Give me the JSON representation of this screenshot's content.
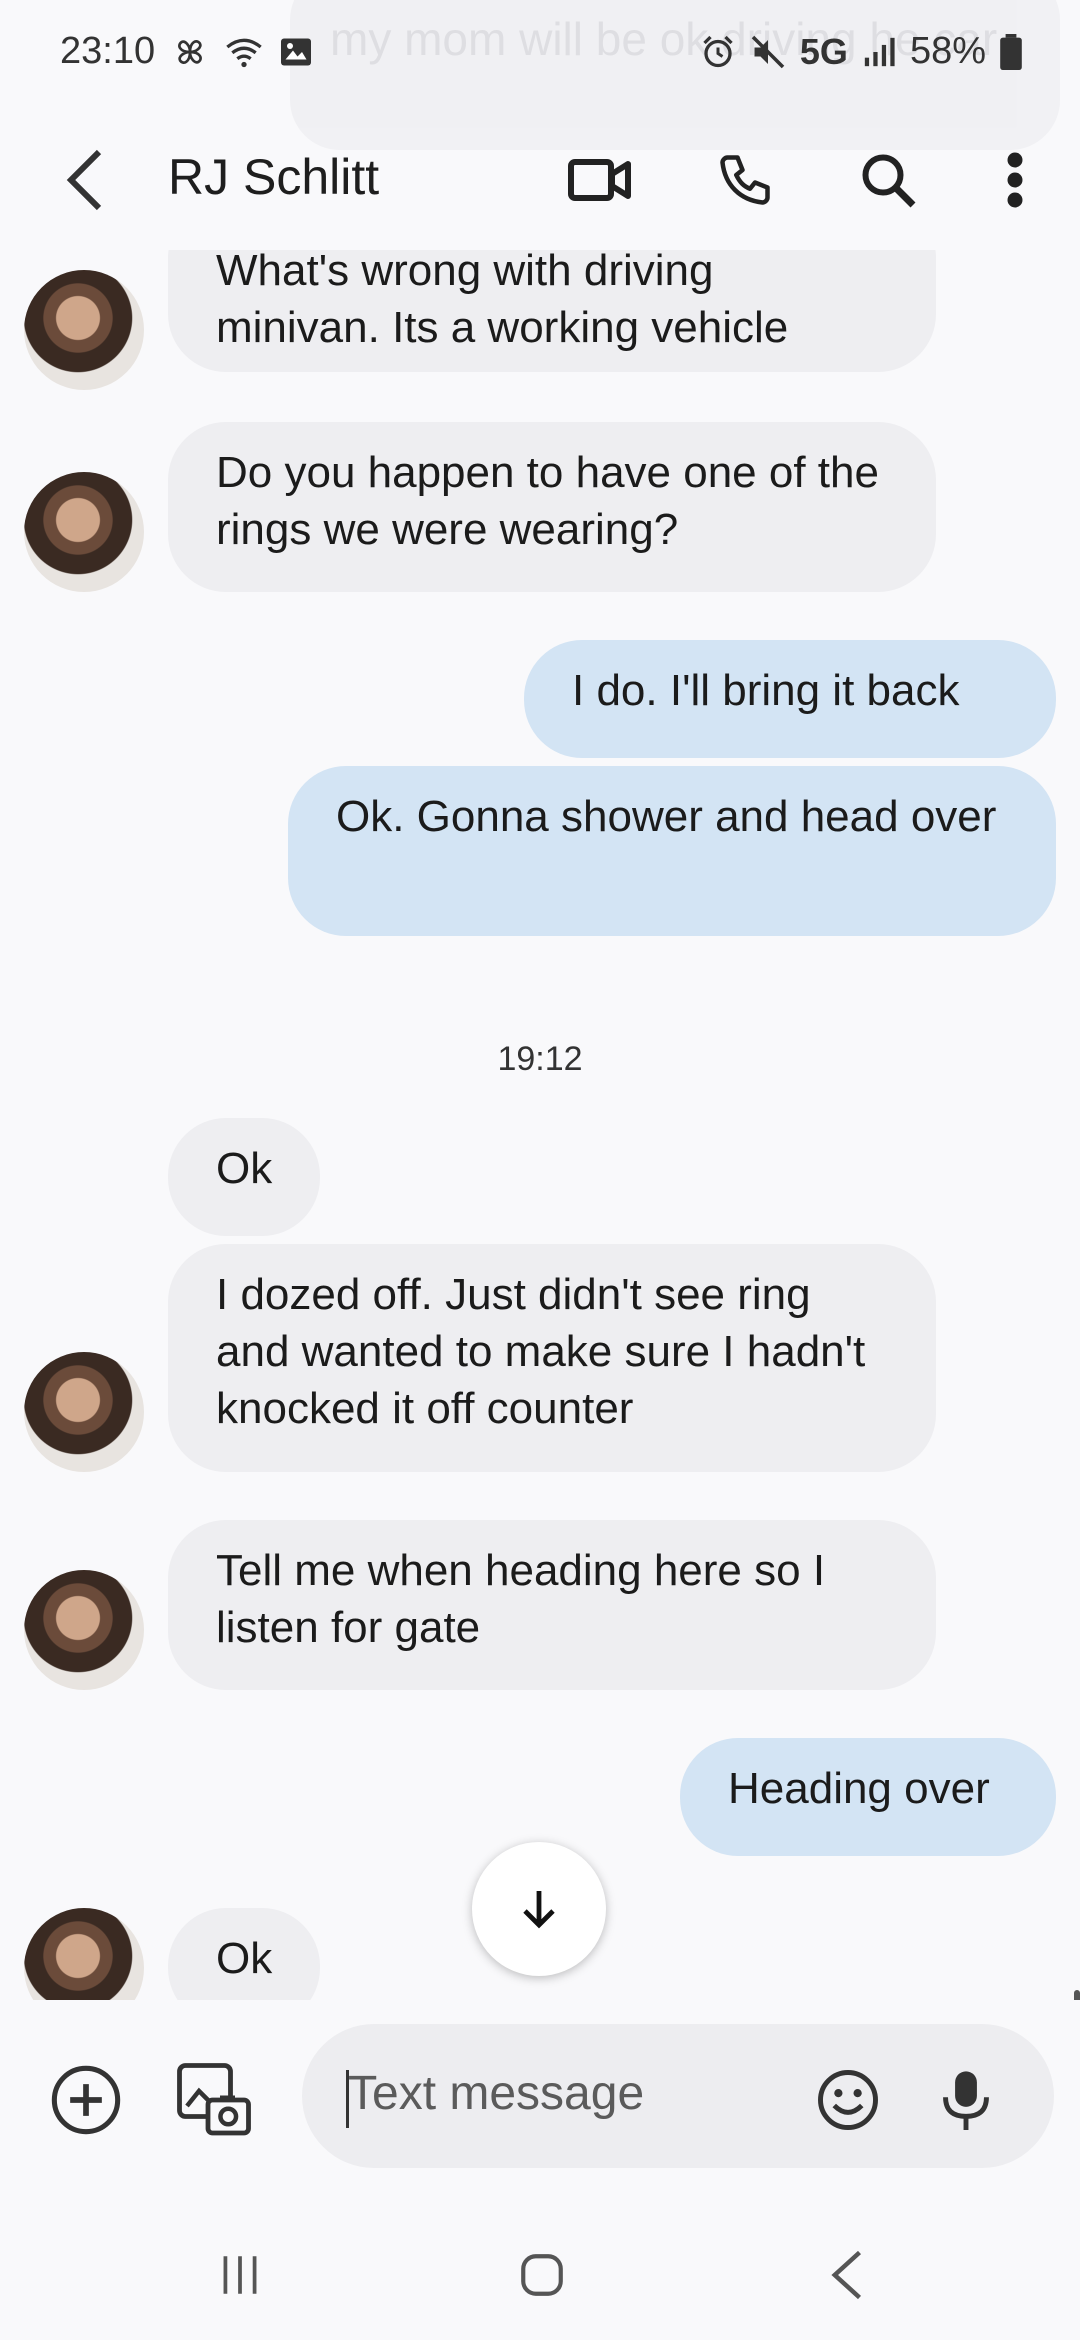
{
  "status_bar": {
    "time": "23:10",
    "network": "5G",
    "battery": "58%"
  },
  "background_message": {
    "text": "my mom will be ok driving he car"
  },
  "header": {
    "contact_name": "RJ Schlitt"
  },
  "messages": [
    {
      "dir": "in",
      "text": "What's wrong with driving minivan. Its a working vehicle"
    },
    {
      "dir": "in",
      "text": "Do you happen to have one of the rings we were wearing?"
    },
    {
      "dir": "out",
      "text": "I do. I'll bring it back"
    },
    {
      "dir": "out",
      "text": "Ok. Gonna shower and head over"
    },
    {
      "dir": "in",
      "text": "Ok"
    },
    {
      "dir": "in",
      "text": "I dozed off. Just didn't see ring and wanted to make sure I hadn't knocked it off counter"
    },
    {
      "dir": "in",
      "text": "Tell me when heading here so I listen for gate"
    },
    {
      "dir": "out",
      "text": "Heading over"
    },
    {
      "dir": "in",
      "text": "Ok"
    }
  ],
  "timestamp": "19:12",
  "composer": {
    "placeholder": "Text message"
  },
  "icons": {
    "back": "back-arrow-icon",
    "video": "video-call-icon",
    "call": "phone-icon",
    "search": "search-icon",
    "more": "more-vert-icon",
    "add": "add-circle-icon",
    "gallery": "gallery-camera-icon",
    "emoji": "emoji-icon",
    "mic": "mic-icon",
    "scroll_down": "arrow-down-icon"
  },
  "colors": {
    "incoming_bubble": "#eeeef1",
    "outgoing_bubble": "#d3e4f4",
    "background": "#f9f9fb"
  }
}
